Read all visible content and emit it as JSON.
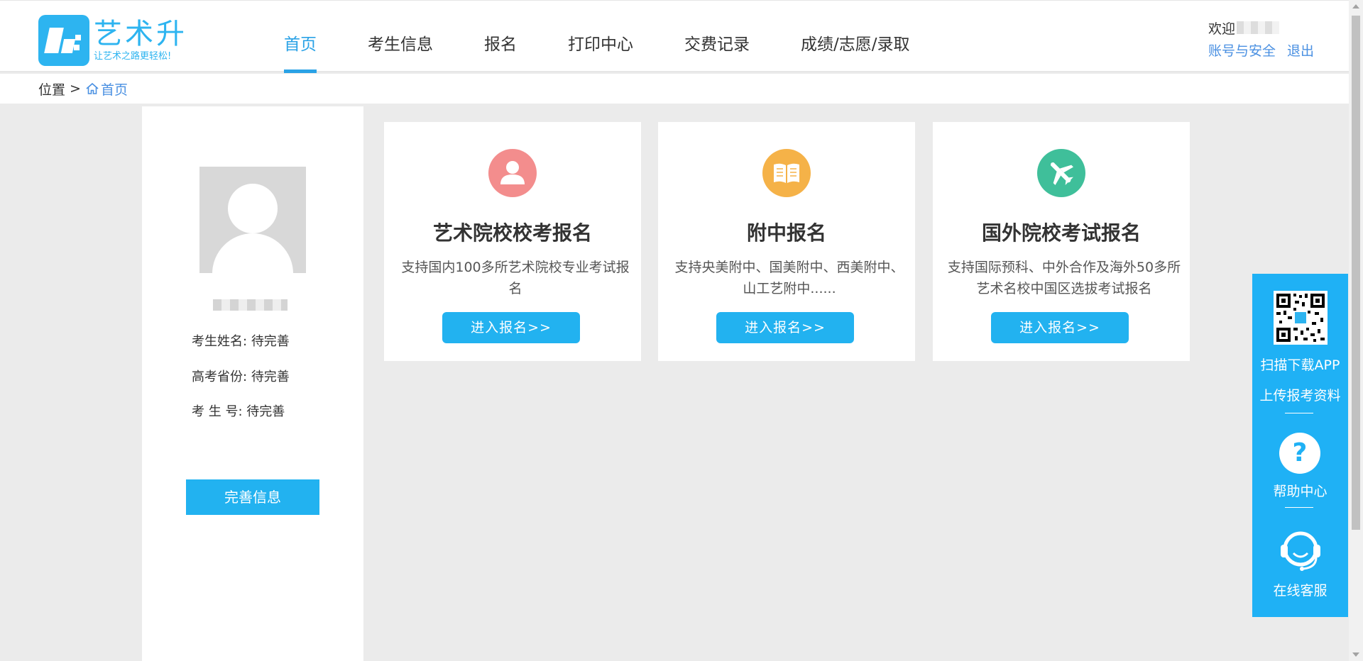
{
  "brand": {
    "title": "艺术升",
    "slogan": "让艺术之路更轻松!",
    "color": "#2db4f0"
  },
  "nav": [
    {
      "label": "首页",
      "active": true
    },
    {
      "label": "考生信息"
    },
    {
      "label": "报名"
    },
    {
      "label": "打印中心"
    },
    {
      "label": "交费记录"
    },
    {
      "label": "成绩/志愿/录取"
    }
  ],
  "user": {
    "welcome": "欢迎",
    "account_link": "账号与安全",
    "logout_link": "退出"
  },
  "breadcrumb": {
    "label": "位置",
    "separator": ">",
    "current": "首页"
  },
  "profile": {
    "rows": [
      {
        "label": "考生姓名:",
        "value": "待完善"
      },
      {
        "label": "高考省份:",
        "value": "待完善"
      },
      {
        "label": "考 生 号:",
        "value": "待完善"
      }
    ],
    "button": "完善信息"
  },
  "cards": [
    {
      "icon": "person-icon",
      "color": "#f38d8d",
      "title": "艺术院校校考报名",
      "desc": "支持国内100多所艺术院校专业考试报名",
      "button": "进入报名>>"
    },
    {
      "icon": "book-icon",
      "color": "#f5b248",
      "title": "附中报名",
      "desc": "支持央美附中、国美附中、西美附中、山工艺附中......",
      "button": "进入报名>>"
    },
    {
      "icon": "airplane-icon",
      "color": "#3fbf9a",
      "title": "国外院校考试报名",
      "desc": "支持国际预科、中外合作及海外50多所艺术名校中国区选拔考试报名",
      "button": "进入报名>>"
    }
  ],
  "float": {
    "scan_text": "扫描下载APP",
    "upload_text": "上传报考资料",
    "help_symbol": "?",
    "help_text": "帮助中心",
    "service_text": "在线客服"
  },
  "colors": {
    "accent": "#2aa2e6",
    "button": "#22b2f0",
    "float_bg": "#1fb1f5"
  }
}
